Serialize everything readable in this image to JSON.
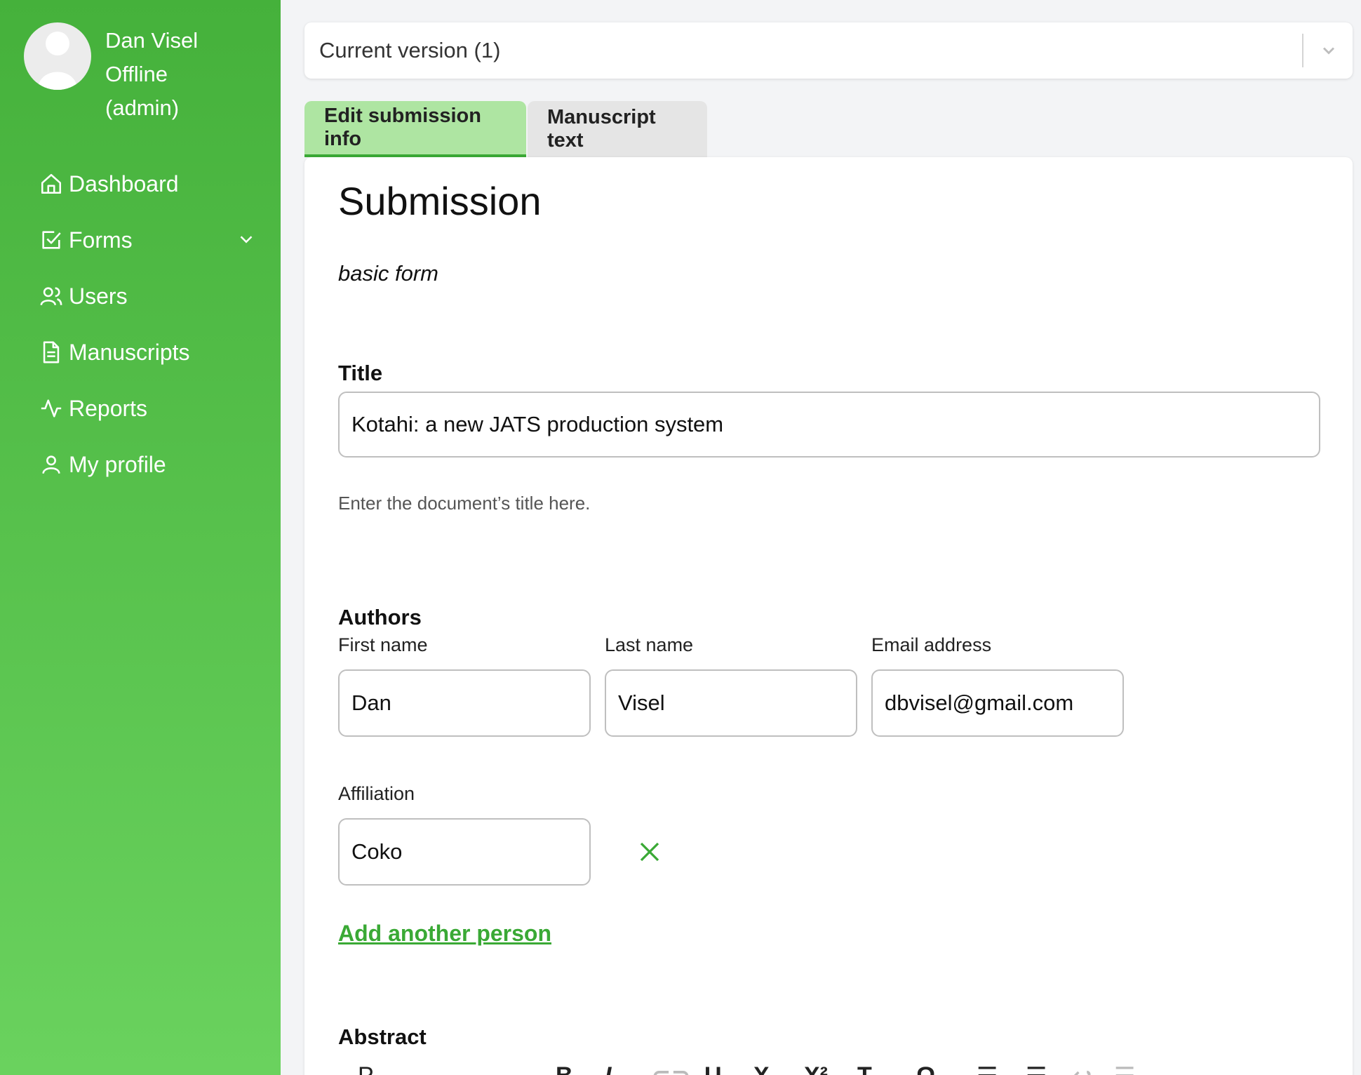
{
  "user": {
    "name": "Dan Visel",
    "status": "Offline",
    "role": "(admin)"
  },
  "nav": {
    "items": [
      {
        "label": "Dashboard",
        "icon": "home-icon"
      },
      {
        "label": "Forms",
        "icon": "checkbox-icon"
      },
      {
        "label": "Users",
        "icon": "users-icon"
      },
      {
        "label": "Manuscripts",
        "icon": "document-icon"
      },
      {
        "label": "Reports",
        "icon": "activity-icon"
      },
      {
        "label": "My profile",
        "icon": "user-icon"
      }
    ]
  },
  "version": {
    "selected": "Current version (1)"
  },
  "tabs": [
    {
      "label": "Edit submission info",
      "active": true
    },
    {
      "label": "Manuscript text",
      "active": false
    }
  ],
  "form": {
    "heading": "Submission",
    "subtitle": "basic form",
    "title_label": "Title",
    "title_value": "Kotahi: a new JATS production system",
    "title_hint": "Enter the document’s title here.",
    "authors_label": "Authors",
    "first_name_label": "First name",
    "last_name_label": "Last name",
    "email_label": "Email address",
    "first_name_value": "Dan",
    "last_name_value": "Visel",
    "email_value": "dbvisel@gmail.com",
    "affiliation_label": "Affiliation",
    "affiliation_value": "Coko",
    "add_person_label": "Add another person",
    "abstract_label": "Abstract"
  },
  "colors": {
    "sidebar_top": "#45b13b",
    "sidebar_bottom": "#6ad25e",
    "accent": "#3aa935",
    "active_tab": "#aee5a2"
  }
}
